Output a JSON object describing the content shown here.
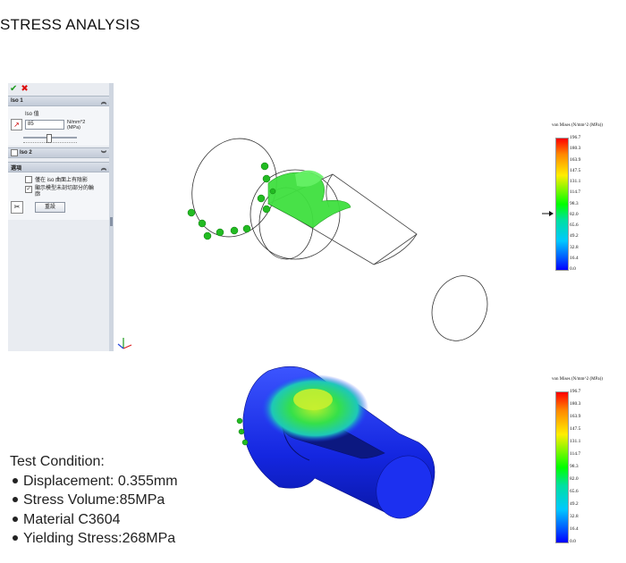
{
  "page": {
    "title": "STRESS ANALYSIS"
  },
  "panel": {
    "section1": {
      "label": "Iso 1",
      "sub_label": "Iso 值",
      "value": "85",
      "units": "N/mm^2\n(MPa)"
    },
    "section2": {
      "label": "Iso 2"
    },
    "options": {
      "label": "選項",
      "opt1": "僅在 iso 曲面上有陰影",
      "opt2": "顯示模型未剖切部分的輪廓",
      "reset_button": "重設"
    }
  },
  "legend": {
    "title": "von Mises (N/mm^2 (MPa))",
    "ticks": [
      "196.7",
      "180.3",
      "163.9",
      "147.5",
      "131.1",
      "114.7",
      "98.3",
      "82.0",
      "65.6",
      "49.2",
      "32.8",
      "16.4",
      "0.0"
    ],
    "colors": {
      "top": "#ff0000",
      "mid": "#00ff00",
      "bottom": "#0000ff"
    }
  },
  "conditions": {
    "heading": "Test Condition:",
    "items": [
      "Displacement: 0.355mm",
      "Stress Volume:85MPa",
      "Material C3604",
      "Yielding Stress:268MPa"
    ]
  }
}
